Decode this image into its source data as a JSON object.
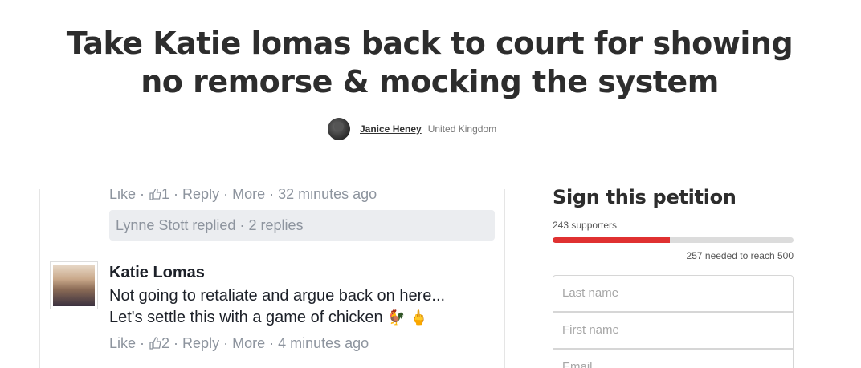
{
  "petition": {
    "title": "Take Katie lomas back to court for showing no remorse & mocking the system",
    "author": {
      "name": "Janice Heney",
      "location": "United Kingdom"
    }
  },
  "screenshot": {
    "top_meta": {
      "like": "Like",
      "likes": "1",
      "reply": "Reply",
      "more": "More",
      "time": "32 minutes ago"
    },
    "replies": {
      "text": "Lynne Stott replied",
      "count": "2 replies"
    },
    "comment": {
      "author": "Katie Lomas",
      "line1": "Not going to retaliate and argue back on here...",
      "line2": "Let's settle this with a game of chicken",
      "like": "Like",
      "likes": "2",
      "reply": "Reply",
      "more": "More",
      "time": "4 minutes ago"
    }
  },
  "sign": {
    "title": "Sign this petition",
    "supporters": "243 supporters",
    "progress_fraction": 0.486,
    "needed": "257 needed to reach 500",
    "fields": {
      "last_name_placeholder": "Last name",
      "first_name_placeholder": "First name",
      "email_placeholder": "Email"
    }
  },
  "colors": {
    "progress": "#e03131",
    "title": "#2d2d2d"
  }
}
